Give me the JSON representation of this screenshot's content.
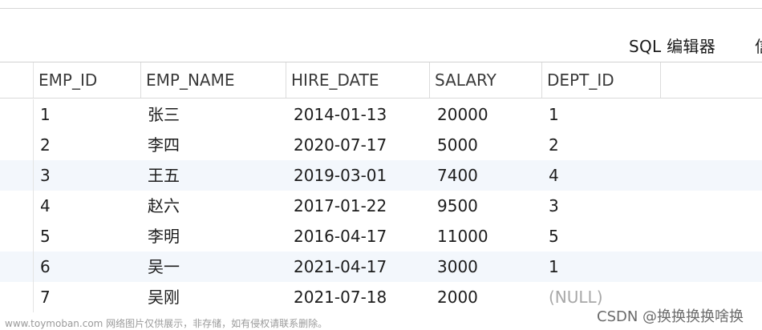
{
  "toolbar": {
    "sql_editor_label": "SQL 编辑器",
    "next_tab_label": "信"
  },
  "table": {
    "columns": [
      "EMP_ID",
      "EMP_NAME",
      "HIRE_DATE",
      "SALARY",
      "DEPT_ID"
    ],
    "rows": [
      [
        "1",
        "张三",
        "2014-01-13",
        "20000",
        "1"
      ],
      [
        "2",
        "李四",
        "2020-07-17",
        "5000",
        "2"
      ],
      [
        "3",
        "王五",
        "2019-03-01",
        "7400",
        "4"
      ],
      [
        "4",
        "赵六",
        "2017-01-22",
        "9500",
        "3"
      ],
      [
        "5",
        "李明",
        "2016-04-17",
        "11000",
        "5"
      ],
      [
        "6",
        "吴一",
        "2021-04-17",
        "3000",
        "1"
      ],
      [
        "7",
        "吴刚",
        "2021-07-18",
        "2000",
        "(NULL)"
      ]
    ],
    "alt_row_color": "#f3f7fc",
    "null_text_color": "#a8a8a8"
  },
  "watermark": {
    "left": "www.toymoban.com 网络图片仅供展示，非存储，如有侵权请联系删除。",
    "right": "CSDN @换换换换啥换"
  }
}
